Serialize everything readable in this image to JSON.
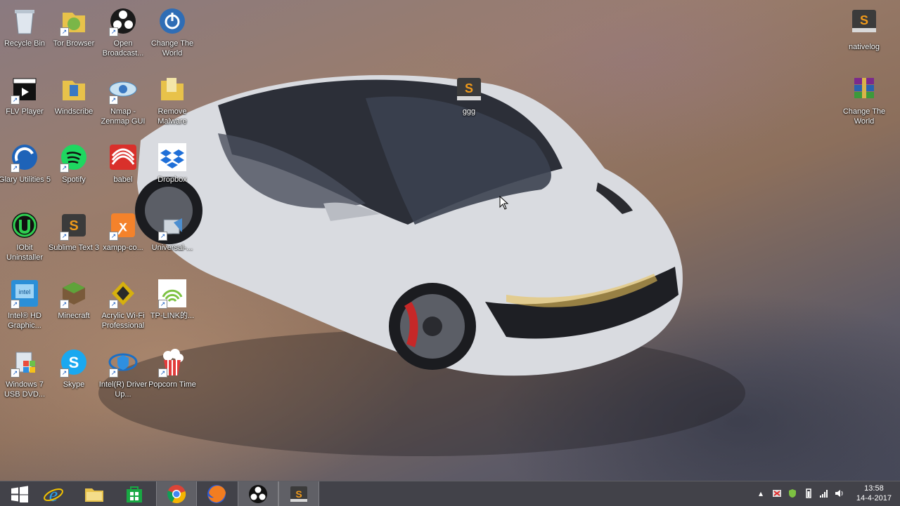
{
  "desktop": {
    "icons": [
      {
        "label": "Recycle Bin",
        "icon": "recycle-bin-icon"
      },
      {
        "label": "Tor Browser",
        "icon": "tor-browser-icon"
      },
      {
        "label": "Open Broadcast...",
        "icon": "obs-icon"
      },
      {
        "label": "Change The World",
        "icon": "power-icon"
      },
      {
        "label": "FLV Player",
        "icon": "clapperboard-icon"
      },
      {
        "label": "Windscribe",
        "icon": "folder-icon"
      },
      {
        "label": "Nmap - Zenmap GUI",
        "icon": "eye-icon"
      },
      {
        "label": "Remove Malware",
        "icon": "folder-icon"
      },
      {
        "label": "Glary Utilities 5",
        "icon": "glary-icon"
      },
      {
        "label": "Spotify",
        "icon": "spotify-icon"
      },
      {
        "label": "babel",
        "icon": "babel-icon"
      },
      {
        "label": "Dropbox",
        "icon": "dropbox-icon"
      },
      {
        "label": "IObit Uninstaller",
        "icon": "iobit-icon"
      },
      {
        "label": "Sublime Text 3",
        "icon": "sublime-icon"
      },
      {
        "label": "xampp-co...",
        "icon": "xampp-icon"
      },
      {
        "label": "Universal-...",
        "icon": "usb-icon"
      },
      {
        "label": "Intel® HD Graphic...",
        "icon": "intel-graphics-icon"
      },
      {
        "label": "Minecraft",
        "icon": "minecraft-icon"
      },
      {
        "label": "Acrylic Wi-Fi Professional",
        "icon": "acrylic-wifi-icon"
      },
      {
        "label": "TP-LINK的...",
        "icon": "tplink-wifi-icon"
      },
      {
        "label": "Windows 7 USB DVD...",
        "icon": "windows-usb-icon"
      },
      {
        "label": "Skype",
        "icon": "skype-icon"
      },
      {
        "label": "Intel(R) Driver Up...",
        "icon": "intel-driver-icon"
      },
      {
        "label": "Popcorn Time",
        "icon": "popcorn-icon"
      },
      {
        "label": "ggg",
        "icon": "sublime-file-icon"
      },
      {
        "label": "nativelog",
        "icon": "sublime-file-icon"
      },
      {
        "label": "Change The World",
        "icon": "winrar-icon"
      }
    ]
  },
  "taskbar": {
    "apps": [
      "start-icon",
      "internet-explorer-icon",
      "file-explorer-icon",
      "store-icon",
      "chrome-icon",
      "firefox-icon",
      "obs-icon",
      "sublime-icon"
    ],
    "clock": {
      "time": "13:58",
      "date": "14-4-2017"
    }
  },
  "colors": {
    "taskbar": "#3c3e48",
    "sublime_orange": "#f09a1a",
    "spotify_green": "#1ed760"
  }
}
